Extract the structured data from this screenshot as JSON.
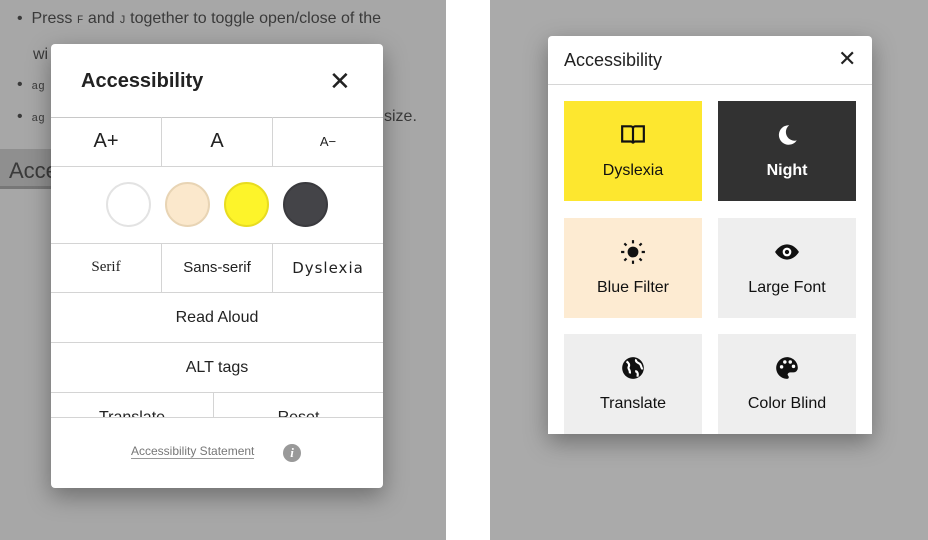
{
  "left": {
    "background": {
      "bullet1": "Press",
      "key1": "F",
      "and": "and",
      "key2": "J",
      "rest": "together to toggle open/close of the",
      "line2": "wi",
      "bullet2": "ag",
      "bullet3": "ag",
      "bullet3_end": "size.",
      "heading": "Acce"
    },
    "title": "Accessibility",
    "size_buttons": [
      "A+",
      "A",
      "A−"
    ],
    "color_options": [
      {
        "name": "white",
        "color": "#ffffff",
        "border": "#e3e3e3"
      },
      {
        "name": "cream",
        "color": "#fbe8cc",
        "border": "#e8d4b4"
      },
      {
        "name": "yellow",
        "color": "#fdf42a",
        "border": "#e8dc20"
      },
      {
        "name": "dark",
        "color": "#444448",
        "border": "#3a3a3e"
      }
    ],
    "font_buttons": [
      "Serif",
      "Sans-serif",
      "Dyslexia"
    ],
    "read_aloud": "Read Aloud",
    "alt_tags": "ALT tags",
    "translate": "Translate",
    "reset": "Reset",
    "statement": "Accessibility Statement"
  },
  "right": {
    "title": "Accessibility",
    "tiles": [
      {
        "label": "Dyslexia",
        "icon": "book-icon",
        "bg": "#fde72f",
        "fg": "#111"
      },
      {
        "label": "Night",
        "icon": "moon-icon",
        "bg": "#323232",
        "fg": "#fff"
      },
      {
        "label": "Blue Filter",
        "icon": "sun-icon",
        "bg": "#fdebd2",
        "fg": "#111"
      },
      {
        "label": "Large Font",
        "icon": "eye-icon",
        "bg": "#eeeeee",
        "fg": "#111"
      },
      {
        "label": "Translate",
        "icon": "globe-icon",
        "bg": "#eeeeee",
        "fg": "#111"
      },
      {
        "label": "Color Blind",
        "icon": "palette-icon",
        "bg": "#eeeeee",
        "fg": "#111"
      }
    ]
  }
}
